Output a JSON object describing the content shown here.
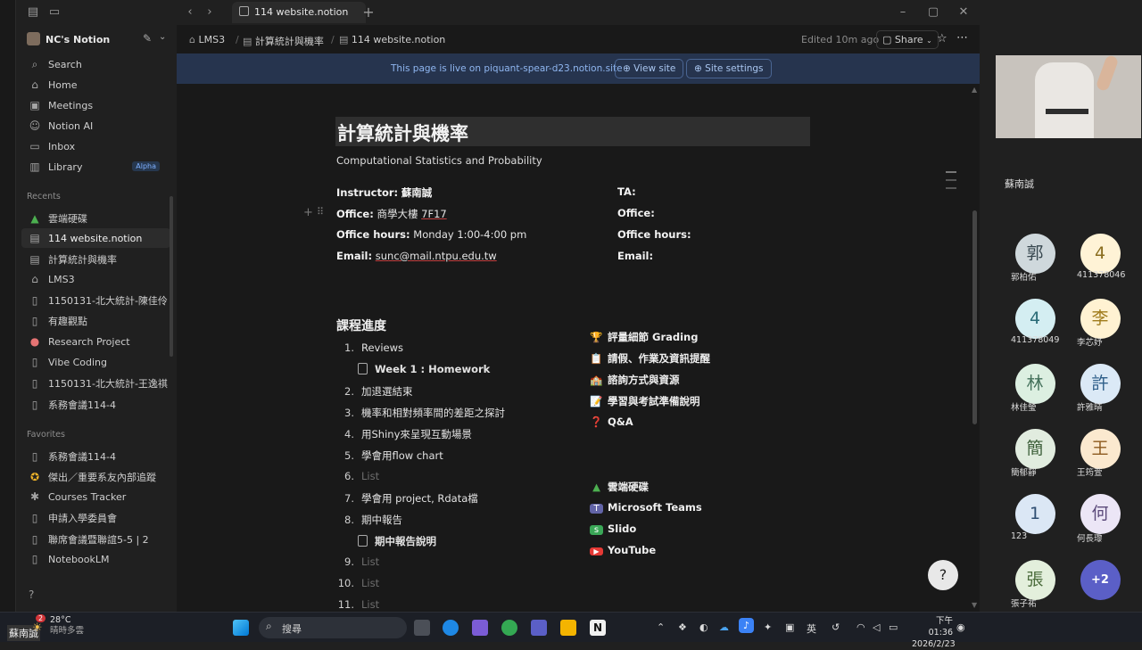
{
  "tab": {
    "title": "114 website.notion",
    "new_tab": "+"
  },
  "window": {
    "minimize": "–",
    "maximize": "▢",
    "close": "✕",
    "back": "‹",
    "forward": "›"
  },
  "sidebar": {
    "workspace": "NC's Notion",
    "top_items": [
      {
        "label": "Search",
        "icon": "search-icon"
      },
      {
        "label": "Home",
        "icon": "home-icon"
      },
      {
        "label": "Meetings",
        "icon": "meetings-icon"
      },
      {
        "label": "Notion AI",
        "icon": "ai-icon"
      },
      {
        "label": "Inbox",
        "icon": "inbox-icon"
      },
      {
        "label": "Library",
        "icon": "library-icon",
        "badge": "Alpha"
      }
    ],
    "recents_label": "Recents",
    "recents": [
      "雲端硬碟",
      "114 website.notion",
      "計算統計與機率",
      "LMS3",
      "1150131-北大統計-陳佳伶",
      "有趣觀點",
      "Research Project",
      "Vibe Coding",
      "1150131-北大統計-王逸祺",
      "系務會議114-4"
    ],
    "favorites_label": "Favorites",
    "favorites": [
      "系務會議114-4",
      "傑出／重要系友內部追蹤",
      "Courses Tracker",
      "申請入學委員會",
      "聯席會議暨聯誼5-5 | 2",
      "NotebookLM"
    ]
  },
  "topbar": {
    "breadcrumb": [
      "LMS3",
      "計算統計與機率",
      "114 website.notion"
    ],
    "edited": "Edited 10m ago",
    "share": "Share"
  },
  "banner": {
    "text": "This page is live on piquant-spear-d23.notion.site",
    "view_site": "View site",
    "site_settings": "Site settings"
  },
  "page": {
    "title": "計算統計與機率",
    "subtitle": "Computational Statistics and Probability",
    "instructor_label": "Instructor:",
    "instructor": "蘇南誠",
    "office_label": "Office:",
    "office_a": "商學大樓",
    "office_b": "7F17",
    "hours_label": "Office hours:",
    "hours": "Monday 1:00-4:00 pm",
    "email_label": "Email:",
    "email": "sunc@mail.ntpu.edu.tw",
    "ta_label": "TA:",
    "ta_office_label": "Office:",
    "ta_hours_label": "Office hours:",
    "ta_email_label": "Email:",
    "schedule_heading": "課程進度",
    "schedule": [
      {
        "n": "1.",
        "t": "Reviews"
      },
      {
        "n": "",
        "t": "Week 1 : Homework",
        "sub": true
      },
      {
        "n": "2.",
        "t": "加退選結束"
      },
      {
        "n": "3.",
        "t": "機率和相對頻率間的差距之探討"
      },
      {
        "n": "4.",
        "t": "用Shiny來呈現互動場景"
      },
      {
        "n": "5.",
        "t": "學會用flow chart"
      },
      {
        "n": "6.",
        "t": "List",
        "placeholder": true
      },
      {
        "n": "7.",
        "t": "學會用 project, Rdata檔"
      },
      {
        "n": "8.",
        "t": "期中報告"
      },
      {
        "n": "",
        "t": "期中報告說明",
        "sub": true
      },
      {
        "n": "9.",
        "t": "List",
        "placeholder": true
      },
      {
        "n": "10.",
        "t": "List",
        "placeholder": true
      },
      {
        "n": "11.",
        "t": "List",
        "placeholder": true
      }
    ],
    "right_links": [
      {
        "icon": "🏆",
        "t": "評量細節 Grading"
      },
      {
        "icon": "📋",
        "t": "請假、作業及資訊提醒"
      },
      {
        "icon": "🏫",
        "t": "諮詢方式與資源"
      },
      {
        "icon": "📝",
        "t": "學習與考試準備說明"
      },
      {
        "icon": "❓",
        "t": "Q&A"
      }
    ],
    "resource_links": [
      {
        "icon": "▲",
        "color": "#4caf50",
        "t": "雲端硬碟"
      },
      {
        "icon": "T",
        "color": "#6264a7",
        "t": "Microsoft Teams"
      },
      {
        "icon": "s",
        "color": "#3aa757",
        "t": "Slido"
      },
      {
        "icon": "▶",
        "color": "#e53935",
        "t": "YouTube"
      }
    ]
  },
  "meeting": {
    "presenter": "蘇南誠",
    "participants": [
      {
        "avatar": "郭",
        "name": "郭柏佑",
        "bg": "#cfd8dc",
        "fg": "#37474f"
      },
      {
        "avatar": "4",
        "name": "411378046",
        "bg": "#fff3d6",
        "fg": "#8a6d1f"
      },
      {
        "avatar": "4",
        "name": "411378049",
        "bg": "#d4eef2",
        "fg": "#2a6b77"
      },
      {
        "avatar": "李",
        "name": "李芯妤",
        "bg": "#fff2d2",
        "fg": "#a07c1c"
      },
      {
        "avatar": "林",
        "name": "林佳瑩",
        "bg": "#dcefe1",
        "fg": "#43705a"
      },
      {
        "avatar": "許",
        "name": "許雅晴",
        "bg": "#dbe9f6",
        "fg": "#2f5f8a"
      },
      {
        "avatar": "簡",
        "name": "簡郁靜",
        "bg": "#e1ecdf",
        "fg": "#3d5f3a"
      },
      {
        "avatar": "王",
        "name": "王筠萱",
        "bg": "#fbe9cf",
        "fg": "#8d5a1e"
      },
      {
        "avatar": "1",
        "name": "123",
        "bg": "#dbe7f5",
        "fg": "#2f4e72"
      },
      {
        "avatar": "何",
        "name": "何長瓈",
        "bg": "#ece6f6",
        "fg": "#5b4a7a"
      },
      {
        "avatar": "張",
        "name": "張子祐",
        "bg": "#e3efdc",
        "fg": "#4a6b3b"
      },
      {
        "avatar": "+2",
        "name": "",
        "bg": "#5b5fc7",
        "fg": "#ffffff"
      }
    ]
  },
  "taskbar": {
    "user": "蘇南誠",
    "temp": "28°C",
    "weather": "晴時多雲",
    "notif": "2",
    "search": "搜尋",
    "ime": "英",
    "time": "下午 01:36",
    "date": "2026/2/23"
  }
}
